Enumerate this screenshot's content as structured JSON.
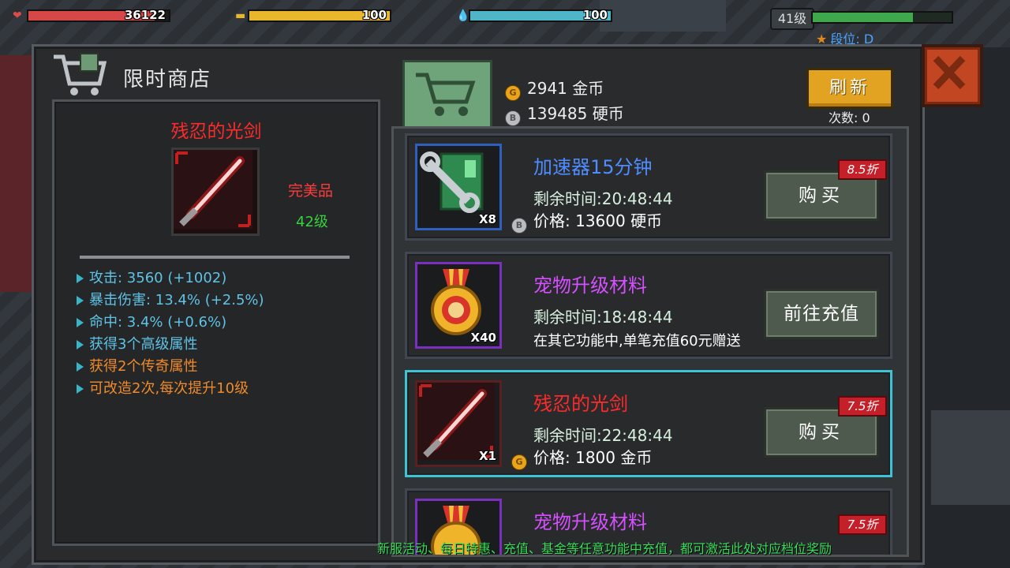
{
  "hud": {
    "health": {
      "value": "36122",
      "fill": 0.9,
      "color": "#d64848"
    },
    "food": {
      "value": "100",
      "fill": 1.0,
      "color": "#e8b72b"
    },
    "water": {
      "value": "100",
      "fill": 1.0,
      "color": "#4fb6c8"
    },
    "level": "41级",
    "xp_fill": 0.72,
    "rank": "段位: D"
  },
  "shop": {
    "title": "限时商店",
    "gold": "2941 金币",
    "silver": "139485 硬币",
    "refresh_label": "刷新",
    "refresh_count": "次数: 0",
    "close_icon": "close-icon"
  },
  "detail": {
    "name": "残忍的光剑",
    "quality": "完美品",
    "level": "42级",
    "stats": [
      {
        "text": "攻击: 3560 (+1002)",
        "color": "#5fc3e6"
      },
      {
        "text": "暴击伤害: 13.4% (+2.5%)",
        "color": "#5fc3e6"
      },
      {
        "text": "命中: 3.4% (+0.6%)",
        "color": "#5fc3e6"
      },
      {
        "text": "获得3个高级属性",
        "color": "#5fc3e6"
      },
      {
        "text": "获得2个传奇属性",
        "color": "#f08a2a"
      },
      {
        "text": "可改造2次,每次提升10级",
        "color": "#f08a2a"
      }
    ]
  },
  "items": [
    {
      "name": "加速器15分钟",
      "name_color": "#4f8cff",
      "qty": "X8",
      "time": "剩余时间:20:48:44",
      "price": "价格: 13600 硬币",
      "coin": "silver",
      "button": "购买",
      "discount": "8.5折"
    },
    {
      "name": "宠物升级材料",
      "name_color": "#d64fff",
      "qty": "X40",
      "time": "剩余时间:18:48:44",
      "desc": "在其它功能中,单笔充值60元赠送",
      "button": "前往充值"
    },
    {
      "name": "残忍的光剑",
      "name_color": "#ff2a2a",
      "qty": "X1",
      "time": "剩余时间:22:48:44",
      "price": "价格: 1800 金币",
      "coin": "gold",
      "button": "购买",
      "discount": "7.5折"
    },
    {
      "name": "宠物升级材料",
      "name_color": "#d64fff",
      "discount": "7.5折"
    }
  ],
  "footer": "新服活动、每日特惠、充值、基金等任意功能中充值，都可激活此处对应档位奖励"
}
